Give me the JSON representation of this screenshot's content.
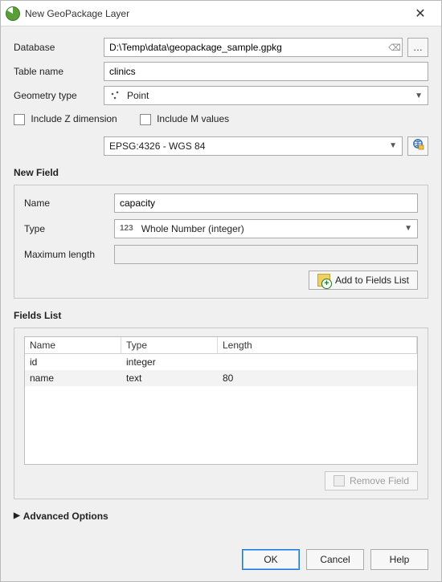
{
  "window": {
    "title": "New GeoPackage Layer"
  },
  "labels": {
    "database": "Database",
    "table_name": "Table name",
    "geometry_type": "Geometry type",
    "include_z": "Include Z dimension",
    "include_m": "Include M values",
    "new_field": "New Field",
    "name": "Name",
    "type": "Type",
    "max_length": "Maximum length",
    "fields_list": "Fields List",
    "advanced": "Advanced Options"
  },
  "values": {
    "database_path": "D:\\Temp\\data\\geopackage_sample.gpkg",
    "table_name": "clinics",
    "geometry_type": "Point",
    "crs": "EPSG:4326 - WGS 84",
    "field_name": "capacity",
    "field_type": "Whole Number (integer)",
    "max_length": ""
  },
  "fields_table": {
    "headers": {
      "name": "Name",
      "type": "Type",
      "length": "Length"
    },
    "rows": [
      {
        "name": "id",
        "type": "integer",
        "length": ""
      },
      {
        "name": "name",
        "type": "text",
        "length": "80"
      }
    ]
  },
  "buttons": {
    "browse": "…",
    "add_to_fields": "Add to Fields List",
    "remove_field": "Remove Field",
    "ok": "OK",
    "cancel": "Cancel",
    "help": "Help"
  },
  "glyphs": {
    "close": "✕",
    "clear": "⌫",
    "dropdown": "▼",
    "num123": "123",
    "tri_right": "▶"
  }
}
